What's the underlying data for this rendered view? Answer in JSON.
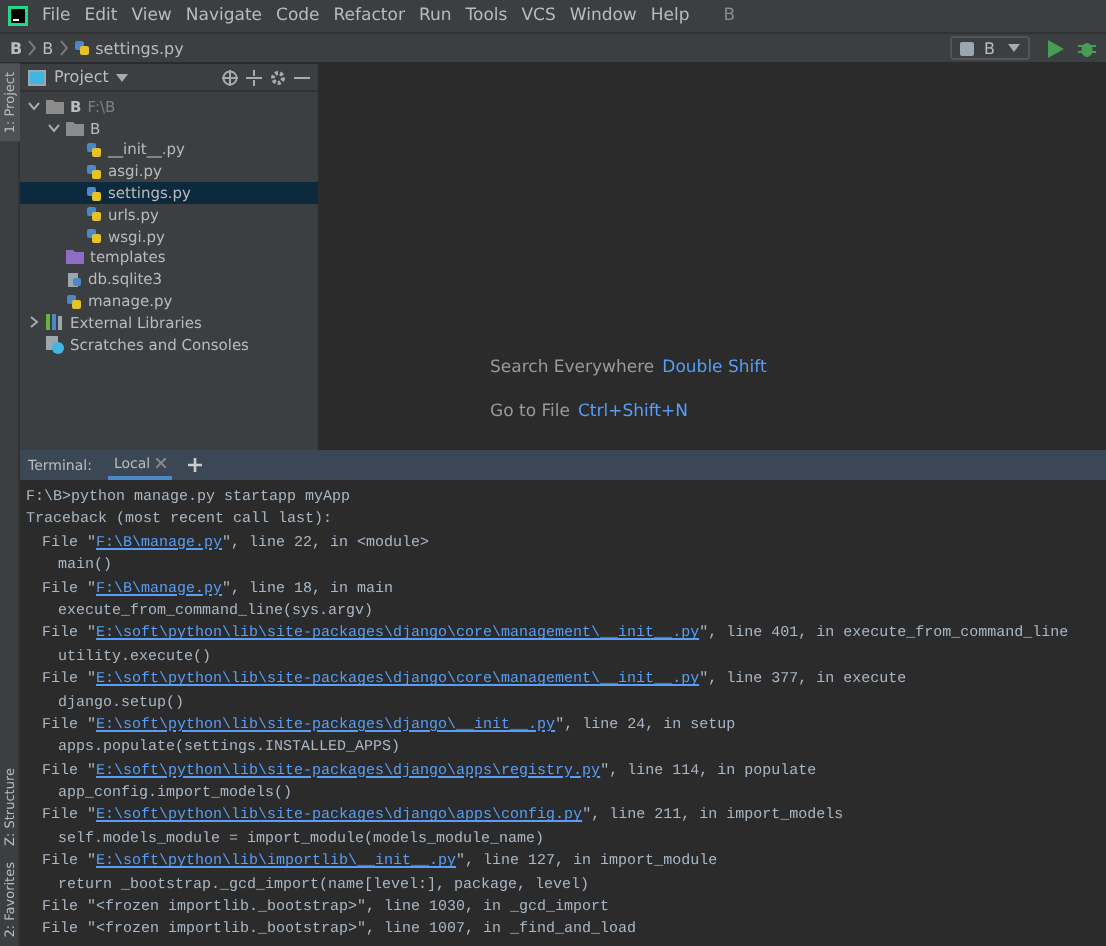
{
  "menu": {
    "items": [
      "File",
      "Edit",
      "View",
      "Navigate",
      "Code",
      "Refactor",
      "Run",
      "Tools",
      "VCS",
      "Window",
      "Help"
    ],
    "title": "B"
  },
  "breadcrumbs": [
    "B",
    "B",
    "settings.py"
  ],
  "run_config": {
    "label": "B"
  },
  "tool_strip": {
    "top": [
      {
        "label": "1: Project",
        "selected": true
      }
    ],
    "bottom": [
      {
        "label": "Z: Structure",
        "selected": false
      },
      {
        "label": "2: Favorites",
        "selected": false
      }
    ]
  },
  "project": {
    "title": "Project",
    "tree": [
      {
        "label": "B",
        "path": "F:\\B",
        "kind": "root",
        "expanded": true,
        "selected": false,
        "children": [
          {
            "label": "B",
            "kind": "package",
            "expanded": true,
            "selected": false,
            "children": [
              {
                "label": "__init__.py",
                "kind": "python",
                "selected": false
              },
              {
                "label": "asgi.py",
                "kind": "python",
                "selected": false
              },
              {
                "label": "settings.py",
                "kind": "python",
                "selected": true
              },
              {
                "label": "urls.py",
                "kind": "python",
                "selected": false
              },
              {
                "label": "wsgi.py",
                "kind": "python",
                "selected": false
              }
            ]
          },
          {
            "label": "templates",
            "kind": "templates",
            "selected": false
          },
          {
            "label": "db.sqlite3",
            "kind": "db",
            "selected": false
          },
          {
            "label": "manage.py",
            "kind": "python",
            "selected": false
          }
        ]
      },
      {
        "label": "External Libraries",
        "kind": "libraries",
        "expanded": false,
        "selected": false
      },
      {
        "label": "Scratches and Consoles",
        "kind": "scratches",
        "selected": false
      }
    ]
  },
  "editor_hints": [
    {
      "action": "Search Everywhere",
      "shortcut": "Double Shift"
    },
    {
      "action": "Go to File",
      "shortcut": "Ctrl+Shift+N"
    }
  ],
  "terminal": {
    "title": "Terminal:",
    "tabs": [
      {
        "label": "Local",
        "selected": true
      }
    ],
    "lines": [
      {
        "kind": "top",
        "text": "F:\\B>python manage.py startapp myApp"
      },
      {
        "kind": "top",
        "text": "Traceback (most recent call last):"
      },
      {
        "kind": "frame",
        "before": "File \"",
        "link": "F:\\B\\manage.py",
        "after": "\", line 22, in <module>"
      },
      {
        "kind": "code",
        "text": "main()"
      },
      {
        "kind": "frame",
        "before": "File \"",
        "link": "F:\\B\\manage.py",
        "after": "\", line 18, in main"
      },
      {
        "kind": "code",
        "text": "execute_from_command_line(sys.argv)"
      },
      {
        "kind": "frame",
        "before": "File \"",
        "link": "E:\\soft\\python\\lib\\site-packages\\django\\core\\management\\__init__.py",
        "after": "\", line 401, in execute_from_command_line"
      },
      {
        "kind": "code",
        "text": "utility.execute()"
      },
      {
        "kind": "frame",
        "before": "File \"",
        "link": "E:\\soft\\python\\lib\\site-packages\\django\\core\\management\\__init__.py",
        "after": "\", line 377, in execute"
      },
      {
        "kind": "code",
        "text": "django.setup()"
      },
      {
        "kind": "frame",
        "before": "File \"",
        "link": "E:\\soft\\python\\lib\\site-packages\\django\\__init__.py",
        "after": "\", line 24, in setup"
      },
      {
        "kind": "code",
        "text": "apps.populate(settings.INSTALLED_APPS)"
      },
      {
        "kind": "frame",
        "before": "File \"",
        "link": "E:\\soft\\python\\lib\\site-packages\\django\\apps\\registry.py",
        "after": "\", line 114, in populate"
      },
      {
        "kind": "code",
        "text": "app_config.import_models()"
      },
      {
        "kind": "frame",
        "before": "File \"",
        "link": "E:\\soft\\python\\lib\\site-packages\\django\\apps\\config.py",
        "after": "\", line 211, in import_models"
      },
      {
        "kind": "code",
        "text": "self.models_module = import_module(models_module_name)"
      },
      {
        "kind": "frame",
        "before": "File \"",
        "link": "E:\\soft\\python\\lib\\importlib\\__init__.py",
        "after": "\", line 127, in import_module"
      },
      {
        "kind": "code",
        "text": "return _bootstrap._gcd_import(name[level:], package, level)"
      },
      {
        "kind": "frame",
        "text": "File \"<frozen importlib._bootstrap>\", line 1030, in _gcd_import"
      },
      {
        "kind": "frame",
        "text": "File \"<frozen importlib._bootstrap>\", line 1007, in _find_and_load"
      }
    ]
  }
}
